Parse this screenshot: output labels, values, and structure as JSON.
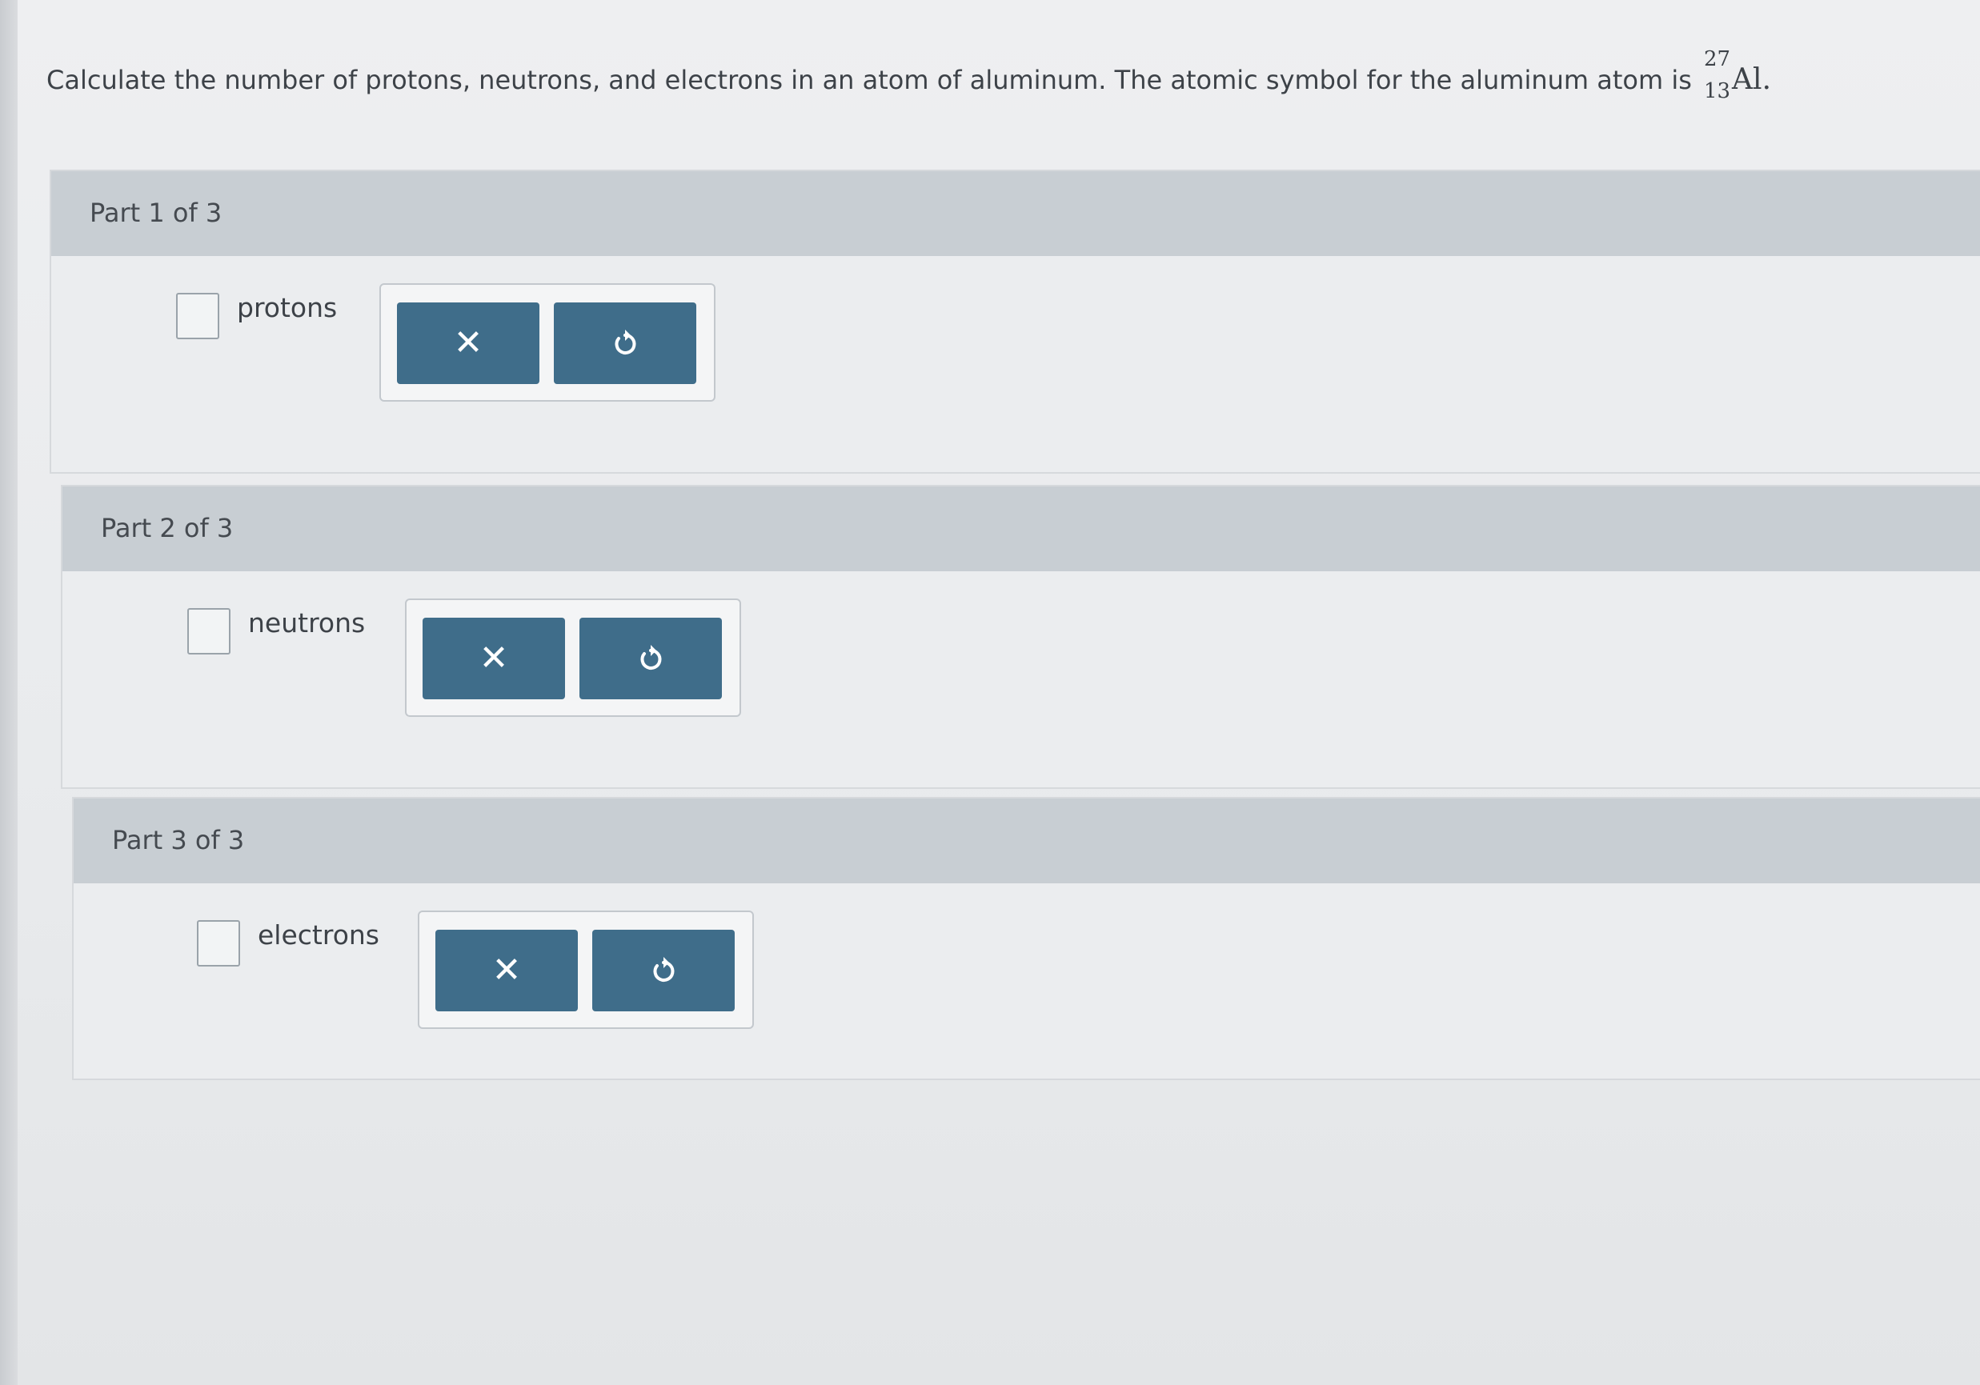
{
  "question": {
    "text": "Calculate the number of protons, neutrons, and electrons in an atom of aluminum. The atomic symbol for the aluminum atom is ",
    "isotope": {
      "mass_number": "27",
      "atomic_number": "13",
      "symbol": "Al"
    },
    "end": "."
  },
  "parts": [
    {
      "title": "Part 1 of 3",
      "unit": "protons",
      "clear_symbol": "✕"
    },
    {
      "title": "Part 2 of 3",
      "unit": "neutrons",
      "clear_symbol": "✕"
    },
    {
      "title": "Part 3 of 3",
      "unit": "electrons",
      "clear_symbol": "✕"
    }
  ],
  "colors": {
    "button": "#3f6d8a",
    "header": "#c8ced3",
    "panel": "#ebedef"
  }
}
